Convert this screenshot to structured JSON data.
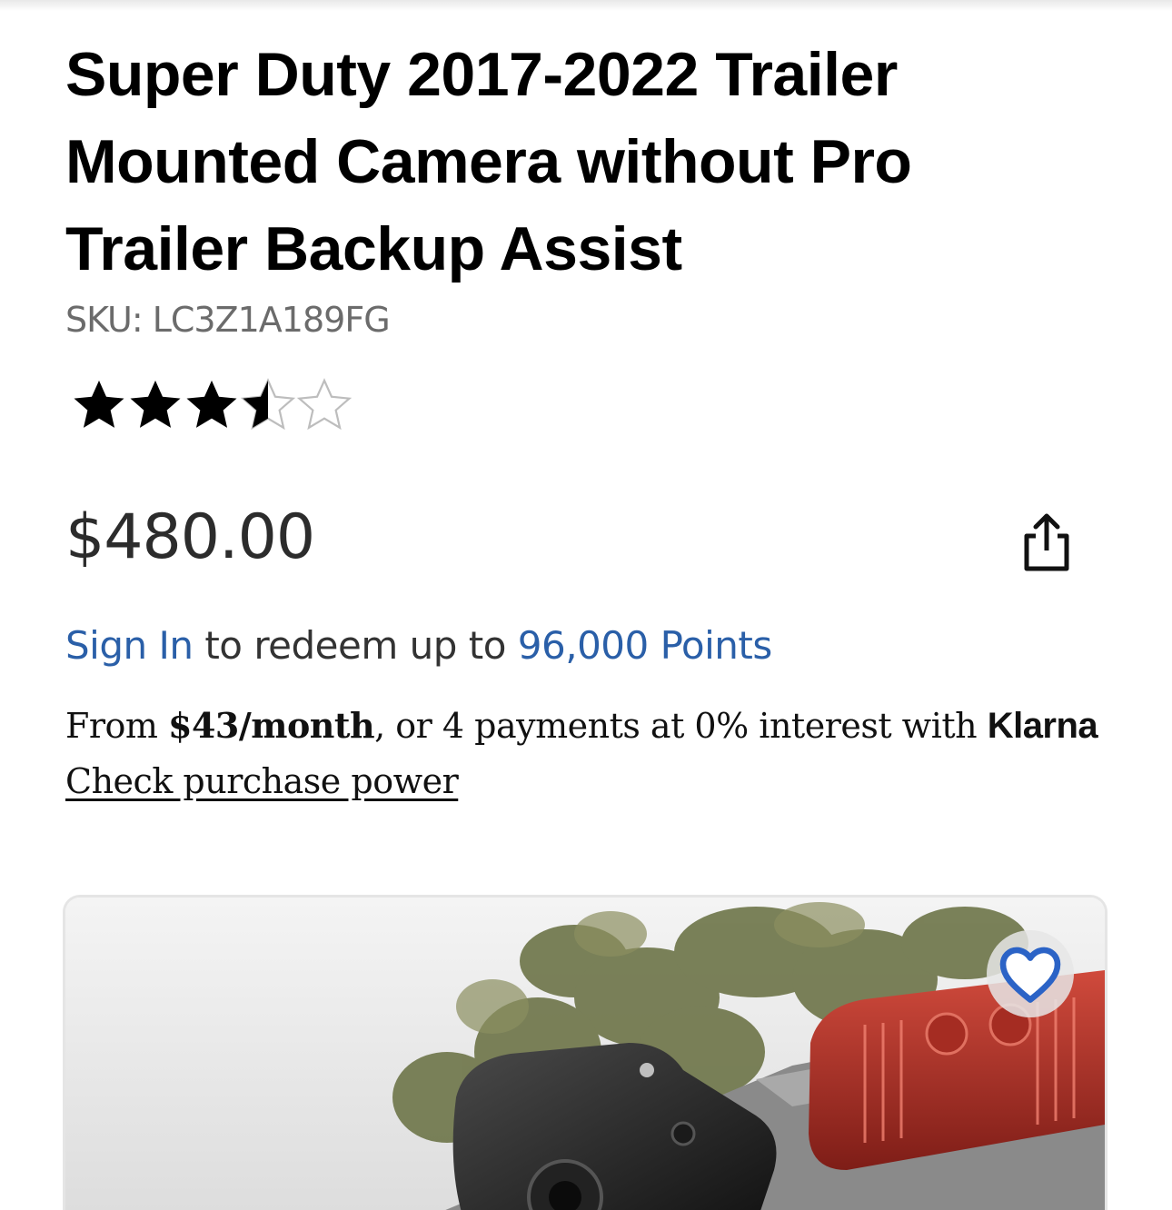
{
  "product": {
    "title": "Super Duty 2017-2022 Trailer Mounted Camera without Pro Trailer Backup Assist",
    "sku_label": "SKU: LC3Z1A189FG",
    "rating": 3.5,
    "rating_max": 5,
    "price": "$480.00"
  },
  "points": {
    "sign_in": "Sign In",
    "middle": " to redeem up to ",
    "amount": "96,000 Points"
  },
  "financing": {
    "prefix": "From ",
    "monthly": "$43/month",
    "middle": ", or 4 payments at 0% interest with ",
    "brand": "Klarna",
    "check_link": "Check purchase power"
  },
  "icons": {
    "share": "share-icon",
    "favorite": "heart-icon",
    "star": "star-icon"
  },
  "colors": {
    "link_blue": "#2a5fa8",
    "favorite_blue": "#2b63c6",
    "star_filled": "#000000",
    "star_empty": "#bdbdbd"
  }
}
